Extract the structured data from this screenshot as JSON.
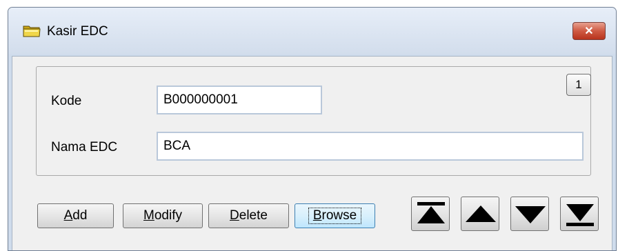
{
  "window": {
    "title": "Kasir EDC",
    "close_label": "✕",
    "title_icon": "folder-icon"
  },
  "record": {
    "number": "1"
  },
  "form": {
    "kode": {
      "label": "Kode",
      "value": "B000000001"
    },
    "nama_edc": {
      "label": "Nama EDC",
      "value": "BCA"
    }
  },
  "buttons": {
    "add": {
      "mnemonic": "A",
      "rest": "dd"
    },
    "modify": {
      "mnemonic": "M",
      "rest": "odify"
    },
    "delete": {
      "mnemonic": "D",
      "rest": "elete"
    },
    "browse": {
      "mnemonic": "B",
      "rest": "rowse"
    }
  },
  "navigation": {
    "icons": [
      "first-record-icon",
      "previous-record-icon",
      "next-record-icon",
      "last-record-icon"
    ]
  },
  "colors": {
    "close_button": "#c94a34",
    "focus_border": "#3c7fb1"
  }
}
